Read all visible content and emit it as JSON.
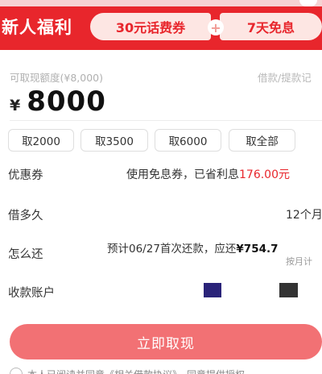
{
  "banner": {
    "title": "新人福利",
    "coupon": "30元话费券",
    "plus": "+",
    "free_interest": "7天免息"
  },
  "withdraw": {
    "quota_label": "可取现额度(¥8,000)",
    "record_link": "借款/提款记",
    "currency": "¥",
    "amount": "8000",
    "chips": [
      "取2000",
      "取3500",
      "取6000",
      "取全部"
    ]
  },
  "rows": {
    "coupon_label": "优惠券",
    "coupon_text": "使用免息券，已省利息",
    "coupon_value": "176.00元",
    "term_label": "借多久",
    "term_value": "12个月",
    "repay_label": "怎么还",
    "repay_text": "预计06/27首次还款，应还",
    "repay_amount": "¥754.7",
    "repay_sub": "按月计",
    "account_label": "收款账户"
  },
  "colors": {
    "brand_red": "#e8262c",
    "cta": "#f27174"
  },
  "cta": {
    "label": "立即取现"
  },
  "agreement": {
    "text": "本人已阅读并同意《相关借款协议》，同意提供授权"
  }
}
